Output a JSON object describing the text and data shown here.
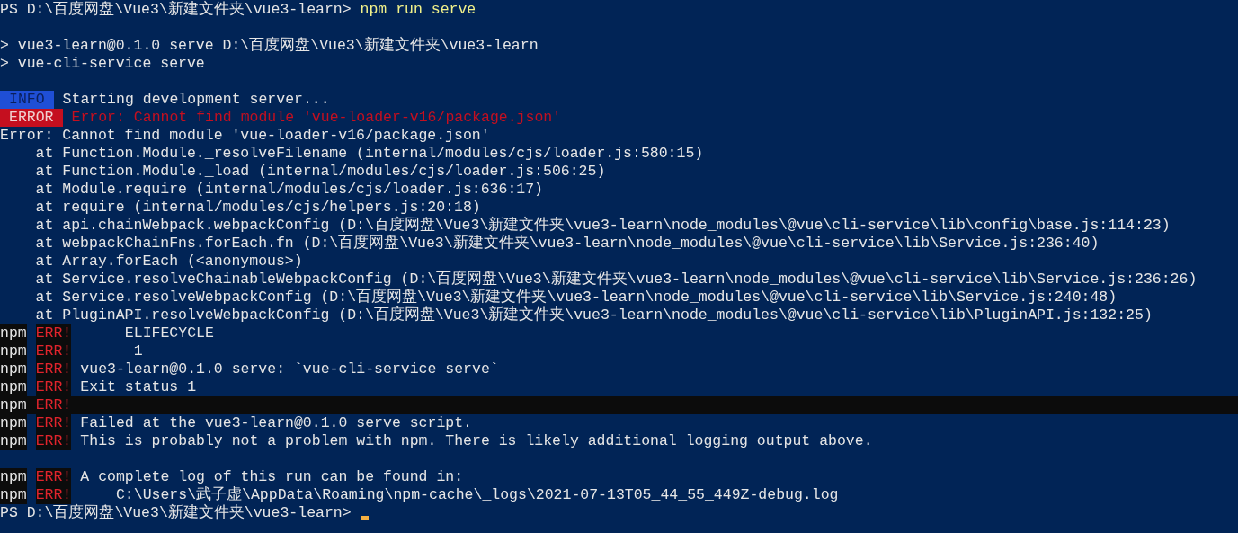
{
  "terminal": {
    "lines": [
      {
        "kind": "prompt",
        "path": "PS D:\\百度网盘\\Vue3\\新建文件夹\\vue3-learn>",
        "command": "npm run serve",
        "cursor": false
      },
      {
        "kind": "blank"
      },
      {
        "kind": "text",
        "text": "> vue3-learn@0.1.0 serve D:\\百度网盘\\Vue3\\新建文件夹\\vue3-learn"
      },
      {
        "kind": "text",
        "text": "> vue-cli-service serve"
      },
      {
        "kind": "blank"
      },
      {
        "kind": "badge",
        "badge": "INFO",
        "color": "#1f4fd6",
        "text": "Starting development server..."
      },
      {
        "kind": "badge",
        "badge": "ERROR",
        "color": "#c50f1f",
        "text": "Error: Cannot find module 'vue-loader-v16/package.json'"
      },
      {
        "kind": "text",
        "text": "Error: Cannot find module 'vue-loader-v16/package.json'"
      },
      {
        "kind": "text",
        "text": "    at Function.Module._resolveFilename (internal/modules/cjs/loader.js:580:15)"
      },
      {
        "kind": "text",
        "text": "    at Function.Module._load (internal/modules/cjs/loader.js:506:25)"
      },
      {
        "kind": "text",
        "text": "    at Module.require (internal/modules/cjs/loader.js:636:17)"
      },
      {
        "kind": "text",
        "text": "    at require (internal/modules/cjs/helpers.js:20:18)"
      },
      {
        "kind": "text",
        "text": "    at api.chainWebpack.webpackConfig (D:\\百度网盘\\Vue3\\新建文件夹\\vue3-learn\\node_modules\\@vue\\cli-service\\lib\\config\\base.js:114:23)"
      },
      {
        "kind": "text",
        "text": "    at webpackChainFns.forEach.fn (D:\\百度网盘\\Vue3\\新建文件夹\\vue3-learn\\node_modules\\@vue\\cli-service\\lib\\Service.js:236:40)"
      },
      {
        "kind": "text",
        "text": "    at Array.forEach (<anonymous>)"
      },
      {
        "kind": "text",
        "text": "    at Service.resolveChainableWebpackConfig (D:\\百度网盘\\Vue3\\新建文件夹\\vue3-learn\\node_modules\\@vue\\cli-service\\lib\\Service.js:236:26)"
      },
      {
        "kind": "text",
        "text": "    at Service.resolveWebpackConfig (D:\\百度网盘\\Vue3\\新建文件夹\\vue3-learn\\node_modules\\@vue\\cli-service\\lib\\Service.js:240:48)"
      },
      {
        "kind": "text",
        "text": "    at PluginAPI.resolveWebpackConfig (D:\\百度网盘\\Vue3\\新建文件夹\\vue3-learn\\node_modules\\@vue\\cli-service\\lib\\PluginAPI.js:132:25)"
      },
      {
        "kind": "npm",
        "prefix": "npm",
        "tag": "ERR!",
        "text": "     ELIFECYCLE",
        "highlighted": false
      },
      {
        "kind": "npm",
        "prefix": "npm",
        "tag": "ERR!",
        "text": "      1",
        "highlighted": false
      },
      {
        "kind": "npm",
        "prefix": "npm",
        "tag": "ERR!",
        "text": "vue3-learn@0.1.0 serve: `vue-cli-service serve`",
        "highlighted": false
      },
      {
        "kind": "npm",
        "prefix": "npm",
        "tag": "ERR!",
        "text": "Exit status 1",
        "highlighted": false
      },
      {
        "kind": "npm",
        "prefix": "npm",
        "tag": "ERR!",
        "highlighted": true
      },
      {
        "kind": "npm",
        "prefix": "npm",
        "tag": "ERR!",
        "text": "Failed at the vue3-learn@0.1.0 serve script.",
        "highlighted": false
      },
      {
        "kind": "npm",
        "prefix": "npm",
        "tag": "ERR!",
        "text": "This is probably not a problem with npm. There is likely additional logging output above.",
        "highlighted": false
      },
      {
        "kind": "blank"
      },
      {
        "kind": "npm",
        "prefix": "npm",
        "tag": "ERR!",
        "text": "A complete log of this run can be found in:",
        "highlighted": false
      },
      {
        "kind": "npm",
        "prefix": "npm",
        "tag": "ERR!",
        "text": "    C:\\Users\\武子虚\\AppData\\Roaming\\npm-cache\\_logs\\2021-07-13T05_44_55_449Z-debug.log",
        "highlighted": false
      },
      {
        "kind": "prompt",
        "path": "PS D:\\百度网盘\\Vue3\\新建文件夹\\vue3-learn>",
        "cursor": true
      }
    ]
  }
}
